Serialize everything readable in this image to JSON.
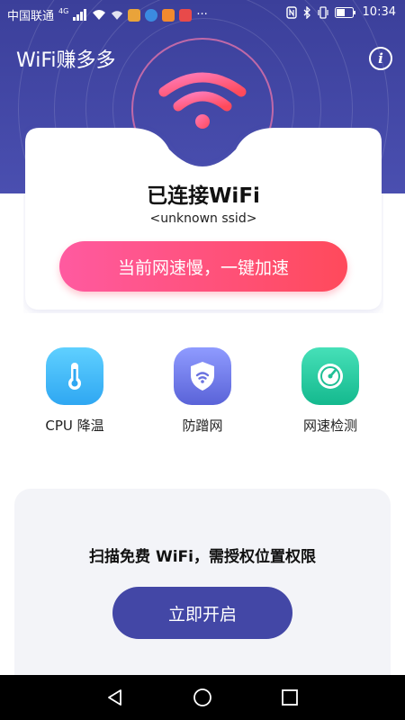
{
  "status_bar": {
    "carrier": "中国联通",
    "network": "4G",
    "more": "···",
    "time": "10:34"
  },
  "header": {
    "title": "WiFi赚多多",
    "info_icon": "info-icon"
  },
  "connection_card": {
    "status": "已连接WiFi",
    "ssid": "<unknown ssid>",
    "boost_button": "当前网速慢，一键加速"
  },
  "tools": [
    {
      "label": "CPU 降温",
      "icon": "thermometer-icon"
    },
    {
      "label": "防蹭网",
      "icon": "shield-wifi-icon"
    },
    {
      "label": "网速检测",
      "icon": "speedometer-icon"
    }
  ],
  "permission_panel": {
    "text": "扫描免费 WiFi，需授权位置权限",
    "button": "立即开启"
  },
  "colors": {
    "header": "#3b3f9a",
    "accent_pink": "#ff5aa0",
    "accent_red": "#ff4a5b",
    "enable_button": "#4347a6"
  }
}
